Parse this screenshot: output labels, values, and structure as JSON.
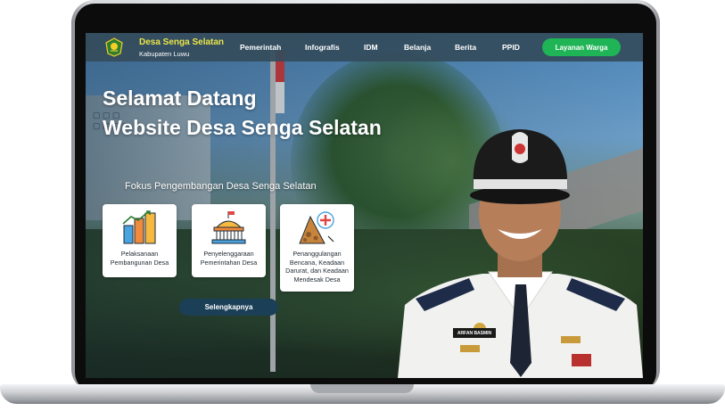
{
  "brand": {
    "title": "Desa Senga Selatan",
    "subtitle": "Kabupaten Luwu",
    "logo_icon": "village-emblem-icon"
  },
  "nav": {
    "items": [
      "Pemerintah",
      "Infografis",
      "IDM",
      "Belanja",
      "Berita",
      "PPID"
    ],
    "cta_label": "Layanan Warga"
  },
  "hero": {
    "line1": "Selamat Datang",
    "line2": "Website Desa Senga Selatan",
    "focus_title": "Fokus Pengembangan Desa Senga Selatan"
  },
  "focus_cards": [
    {
      "icon": "city-buildings-icon",
      "label": "Pelaksanaan Pembangunan Desa"
    },
    {
      "icon": "government-building-icon",
      "label": "Penyelenggaraan Pemerintahan Desa"
    },
    {
      "icon": "disaster-landslide-icon",
      "label": "Penanggulangan Bencana, Keadaan Darurat, dan Keadaan Mendesak Desa"
    }
  ],
  "more_button": "Selengkapnya",
  "official": {
    "nameplate": "ARFAN BASMIN"
  },
  "colors": {
    "navbar": "#344c5c",
    "brand_accent": "#e9e64a",
    "cta": "#1fb455",
    "more_button": "#1b3f57"
  }
}
